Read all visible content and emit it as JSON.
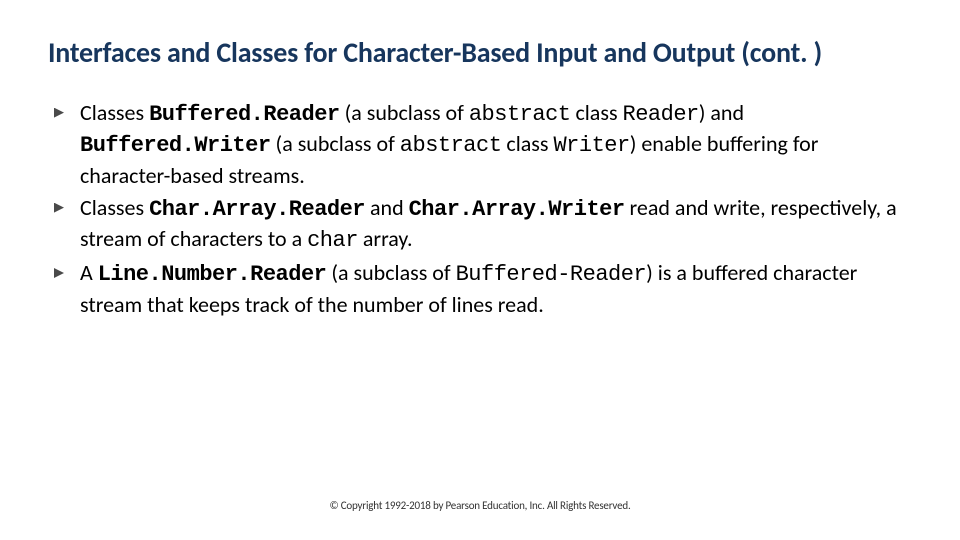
{
  "title": "Interfaces and Classes for Character-Based Input and Output (cont. )",
  "bullets": [
    {
      "parts": [
        {
          "t": "Classes ",
          "c": ""
        },
        {
          "t": "Buffered.Reader",
          "c": "mono"
        },
        {
          "t": " (a subclass of ",
          "c": ""
        },
        {
          "t": "abstract",
          "c": "mono-r"
        },
        {
          "t": " class ",
          "c": ""
        },
        {
          "t": "Reader",
          "c": "mono-r"
        },
        {
          "t": ") and ",
          "c": ""
        },
        {
          "t": "Buffered.Writer",
          "c": "mono"
        },
        {
          "t": " (a subclass of ",
          "c": ""
        },
        {
          "t": "abstract",
          "c": "mono-r"
        },
        {
          "t": " class ",
          "c": ""
        },
        {
          "t": "Writer",
          "c": "mono-r"
        },
        {
          "t": ") enable buffering for character-based streams.",
          "c": ""
        }
      ]
    },
    {
      "parts": [
        {
          "t": "Classes ",
          "c": ""
        },
        {
          "t": "Char.Array.Reader",
          "c": "mono"
        },
        {
          "t": " and ",
          "c": ""
        },
        {
          "t": "Char.Array.Writer",
          "c": "mono"
        },
        {
          "t": " read and write, respectively, a stream of characters to a ",
          "c": ""
        },
        {
          "t": "char",
          "c": "mono-r"
        },
        {
          "t": " array.",
          "c": ""
        }
      ]
    },
    {
      "parts": [
        {
          "t": "A ",
          "c": ""
        },
        {
          "t": "Line.Number.Reader",
          "c": "mono"
        },
        {
          "t": " (a subclass of ",
          "c": ""
        },
        {
          "t": "Buffered-Reader",
          "c": "mono-r"
        },
        {
          "t": ") is a buffered character stream that keeps track of the number of lines read.",
          "c": ""
        }
      ]
    }
  ],
  "footer": "© Copyright 1992-2018 by Pearson Education, Inc. All Rights Reserved."
}
